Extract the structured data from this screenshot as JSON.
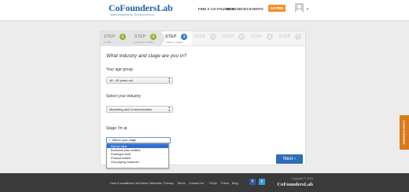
{
  "header": {
    "logo": "CoFoundersLab",
    "tagline": "Matchmaking for Entrepreneurs",
    "nav": [
      "FIND A CO-FOUNDER",
      "RESOURCES",
      "EVENTS"
    ],
    "go_pro": "GO PRO"
  },
  "steps": [
    {
      "word": "STEP",
      "number": "1",
      "sub": "profile",
      "status": "done"
    },
    {
      "word": "STEP",
      "number": "2",
      "sub": "personal details",
      "status": "done"
    },
    {
      "word": "STEP",
      "number": "3",
      "sub": "industry stages",
      "status": "current"
    },
    {
      "word": "STEP",
      "number": "4",
      "sub": "",
      "status": "future"
    },
    {
      "word": "STEP",
      "number": "5",
      "sub": "",
      "status": "future"
    },
    {
      "word": "STEP",
      "number": "6",
      "sub": "",
      "status": "future"
    },
    {
      "word": "STEP",
      "number": "7",
      "sub": "",
      "status": "future"
    }
  ],
  "form": {
    "question": "What industry and stage are you in?",
    "age_label": "Your age group",
    "age_value": "46 - 55 years old",
    "industry_label": "Select your industry",
    "industry_value": "Marketing and Communication",
    "stage_label": "Stage I'm at",
    "stage_select_value": "✓ Select your stage",
    "stage_options": [
      "Got an idea",
      "Business plan drafted",
      "Prototype built",
      "Product tested",
      "Got paying customer"
    ],
    "next_label": "Next"
  },
  "footer": {
    "links": [
      "How it works",
      "About Us",
      "Partner Networks",
      "Privacy",
      "Terms",
      "Contact Us",
      "FAQs",
      "Press",
      "Blog"
    ],
    "copyright": "Copyright © 2013",
    "logo": "CoFoundersLab"
  },
  "feedback_tab": "Leave Feedback",
  "colors": {
    "brand_blue": "#1f64a6",
    "step_done": "#8db92e",
    "step_current": "#3a7bc8",
    "go_pro": "#f0912a",
    "next_button": "#2e6cb7",
    "footer_bg": "#3a3a3a",
    "highlight": "#2f6fd6"
  }
}
